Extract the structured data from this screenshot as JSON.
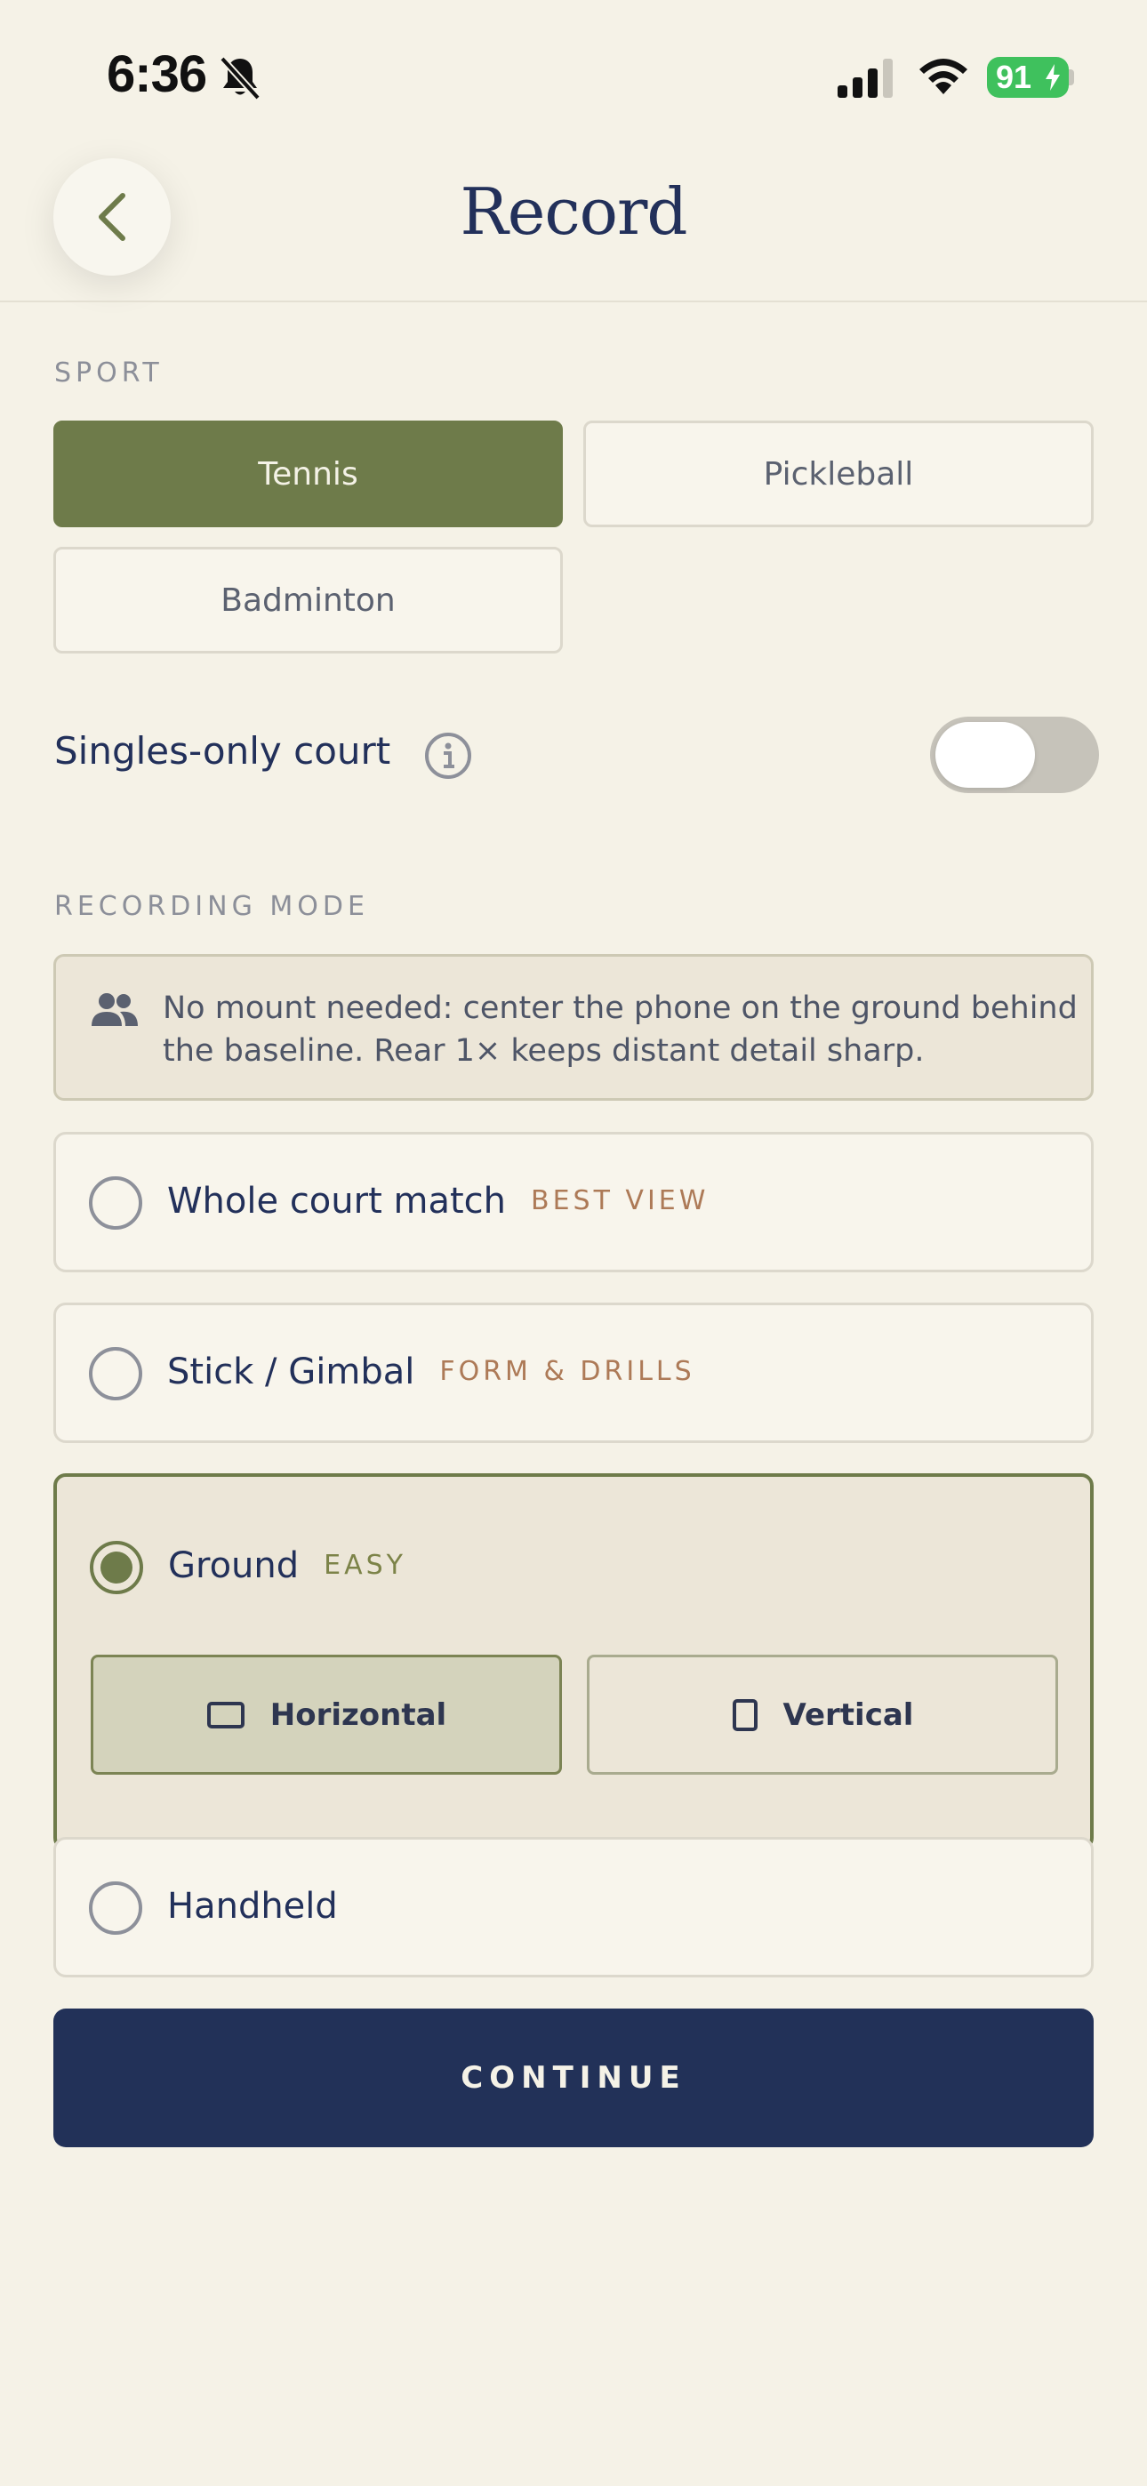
{
  "status_bar": {
    "time": "6:36",
    "battery_level": "91",
    "icons": [
      "bell-slash-icon",
      "signal-icon",
      "wifi-icon",
      "battery-charging-icon"
    ]
  },
  "header": {
    "title": "Record",
    "back_icon": "chevron-left-icon"
  },
  "sport": {
    "label": "SPORT",
    "options": [
      {
        "label": "Tennis",
        "selected": true
      },
      {
        "label": "Pickleball",
        "selected": false
      },
      {
        "label": "Badminton",
        "selected": false
      }
    ]
  },
  "singles": {
    "label": "Singles-only court",
    "enabled": false,
    "info_icon": "info-icon"
  },
  "recording_mode": {
    "label": "RECORDING MODE",
    "note": "No mount needed: center the phone on the ground behind the baseline. Rear 1× keeps distant detail sharp.",
    "note_icon": "people-icon",
    "options": [
      {
        "label": "Whole court match",
        "tag": "BEST VIEW",
        "selected": false
      },
      {
        "label": "Stick / Gimbal",
        "tag": "FORM & DRILLS",
        "selected": false
      },
      {
        "label": "Ground",
        "tag": "EASY",
        "selected": true
      },
      {
        "label": "Handheld",
        "tag": "",
        "selected": false
      }
    ],
    "orientation": {
      "horizontal_label": "Horizontal",
      "vertical_label": "Vertical",
      "selected": "Horizontal"
    }
  },
  "continue_label": "CONTINUE",
  "colors": {
    "background": "#f5f2e7",
    "accent_green": "#6e7b4a",
    "navy": "#223158",
    "tag_brown": "#ad7a57"
  }
}
